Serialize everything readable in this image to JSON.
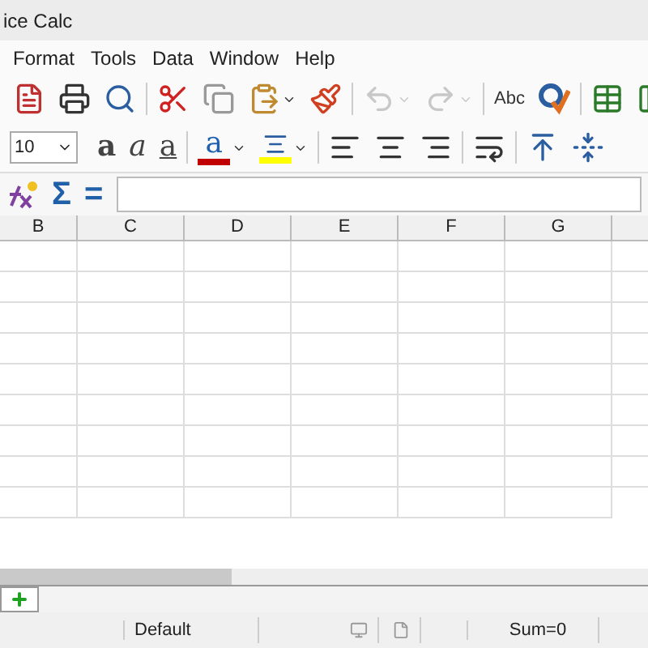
{
  "window": {
    "title": "ice Calc"
  },
  "menu": [
    "Format",
    "Tools",
    "Data",
    "Window",
    "Help"
  ],
  "toolbar_standard": [
    {
      "kind": "pdf"
    },
    {
      "kind": "print"
    },
    {
      "kind": "preview"
    },
    {
      "kind": "sep"
    },
    {
      "kind": "cut"
    },
    {
      "kind": "copy"
    },
    {
      "kind": "paste"
    },
    {
      "kind": "clone"
    },
    {
      "kind": "sep"
    },
    {
      "kind": "undo",
      "disabled": true
    },
    {
      "kind": "redo",
      "disabled": true
    },
    {
      "kind": "sep"
    },
    {
      "kind": "spell",
      "label": "Abc"
    },
    {
      "kind": "autospell"
    },
    {
      "kind": "sep"
    },
    {
      "kind": "rows"
    },
    {
      "kind": "cols"
    }
  ],
  "toolbar_format": {
    "font_size": "10",
    "buttons": [
      {
        "kind": "bold",
        "label": "a"
      },
      {
        "kind": "italic",
        "label": "a"
      },
      {
        "kind": "underline",
        "label": "a"
      },
      {
        "kind": "sep"
      },
      {
        "kind": "fontcolor",
        "label": "a",
        "color": "#c00000"
      },
      {
        "kind": "highlight",
        "color": "#ffff00"
      },
      {
        "kind": "sep"
      },
      {
        "kind": "left"
      },
      {
        "kind": "center"
      },
      {
        "kind": "right"
      },
      {
        "kind": "sep"
      },
      {
        "kind": "wrap"
      },
      {
        "kind": "sep"
      },
      {
        "kind": "top"
      },
      {
        "kind": "vcenter"
      }
    ]
  },
  "formula_bar": {
    "sum_symbol": "Σ",
    "equals": "="
  },
  "columns": [
    "B",
    "C",
    "D",
    "E",
    "F",
    "G"
  ],
  "status_bar": {
    "page_style": "Default",
    "sum": "Sum=0"
  }
}
